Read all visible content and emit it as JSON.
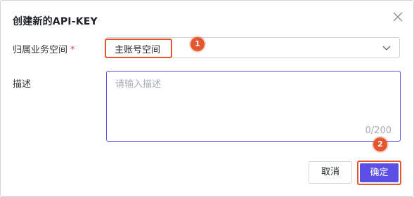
{
  "dialog": {
    "title": "创建新的API-KEY",
    "close_icon": "close-icon"
  },
  "form": {
    "workspace_label": "归属业务空间",
    "required_mark": "*",
    "workspace_value": "主账号空间",
    "description_label": "描述",
    "description_placeholder": "请输入描述",
    "description_counter": "0/200"
  },
  "annotations": {
    "step1": "1",
    "step2": "2",
    "highlight_color": "#e4572e"
  },
  "buttons": {
    "cancel": "取消",
    "confirm": "确定"
  },
  "colors": {
    "accent": "#5b4fe5"
  }
}
